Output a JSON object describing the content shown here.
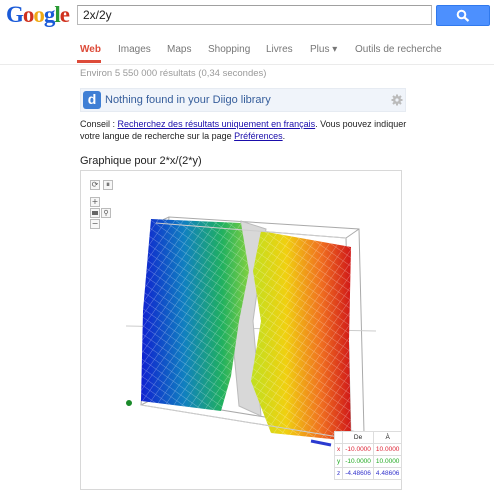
{
  "search": {
    "query": "2x/2y"
  },
  "logo": {
    "letters": [
      "G",
      "o",
      "o",
      "g",
      "l",
      "e"
    ],
    "colors": [
      "#1a5ad8",
      "#d0311e",
      "#f0a913",
      "#1a5ad8",
      "#2a9a34",
      "#d0311e"
    ]
  },
  "nav": {
    "items": [
      "Web",
      "Images",
      "Maps",
      "Shopping",
      "Livres",
      "Plus ▾",
      "Outils de recherche"
    ]
  },
  "stats": "Environ 5 550 000 résultats (0,34 secondes)",
  "diigo": {
    "logo_letter": "d",
    "message": "Nothing found in your Diigo library"
  },
  "advice": {
    "prefix": "Conseil : ",
    "link1": "Recherchez des résultats uniquement en français",
    "middle": ". Vous pouvez indiquer votre langue de recherche sur la page ",
    "link2": "Préférences",
    "suffix": "."
  },
  "graph": {
    "title": "Graphique pour 2*x/(2*y)",
    "controls": {
      "reset": "⟳",
      "pause": "⏸",
      "zoom_in": "+",
      "zoom_out": "−"
    },
    "range_table": {
      "header": [
        "",
        "De",
        "À"
      ],
      "rows": [
        {
          "axis": "x",
          "from": "-10.0000",
          "to": "10.0000"
        },
        {
          "axis": "y",
          "from": "-10.0000",
          "to": "10.0000"
        },
        {
          "axis": "z",
          "from": "-4.48606",
          "to": "4.48606"
        }
      ]
    }
  }
}
